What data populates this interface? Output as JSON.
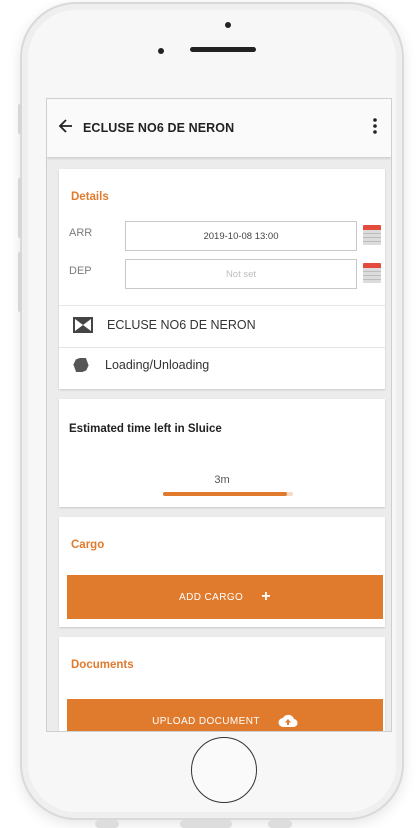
{
  "appbar": {
    "title": "ECLUSE NO6 DE NERON",
    "back_icon": "arrow-left-icon",
    "more_icon": "more-vertical-icon"
  },
  "details": {
    "title": "Details",
    "arr_label": "ARR",
    "arr_value": "2019-10-08 13:00",
    "dep_label": "DEP",
    "dep_placeholder": "Not set",
    "location": "ECLUSE NO6 DE NERON",
    "activity": "Loading/Unloading"
  },
  "estimate": {
    "title": "Estimated time left in Sluice",
    "value": "3m",
    "progress": 0.95
  },
  "cargo": {
    "title": "Cargo",
    "add_label": "ADD CARGO"
  },
  "documents": {
    "title": "Documents",
    "upload_label": "UPLOAD DOCUMENT"
  },
  "colors": {
    "accent": "#e07b2e",
    "calendar_red": "#e44b3d"
  }
}
